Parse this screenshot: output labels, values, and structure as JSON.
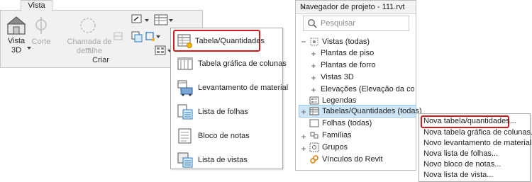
{
  "ribbon": {
    "tab_label": "Vista",
    "view3d_label": "Vista\n3D",
    "cut_label": "Corte",
    "callout_label": "Chamada de detalhe",
    "group_label": "Criar"
  },
  "schedules_menu": {
    "items": [
      {
        "label": "Tabela/Quantidades",
        "icon": "schedule-quantities-icon"
      },
      {
        "label": "Tabela gráfica de colunas",
        "icon": "graphical-column-schedule-icon"
      },
      {
        "label": "Levantamento de material",
        "icon": "material-takeoff-icon"
      },
      {
        "label": "Lista de folhas",
        "icon": "sheet-list-icon"
      },
      {
        "label": "Bloco de notas",
        "icon": "note-block-icon"
      },
      {
        "label": "Lista de vistas",
        "icon": "view-list-icon"
      }
    ],
    "highlight_color": "#d11b1b"
  },
  "project_browser": {
    "title": "Navegador de projeto - 111.rvt",
    "close": "✕",
    "search_placeholder": "Pesquisar",
    "tree": [
      {
        "label": "Vistas (todas)",
        "expander": "−"
      },
      {
        "label": "Plantas de piso",
        "expander": "+"
      },
      {
        "label": "Plantas de forro",
        "expander": "+"
      },
      {
        "label": "Vistas 3D",
        "expander": "+"
      },
      {
        "label": "Elevações (Elevação da constr",
        "expander": "+"
      },
      {
        "label": "Legendas",
        "expander": ""
      },
      {
        "label": "Tabelas/Quantidades (todas)",
        "expander": "+"
      },
      {
        "label": "Folhas (todas)",
        "expander": ""
      },
      {
        "label": "Famílias",
        "expander": "+"
      },
      {
        "label": "Grupos",
        "expander": "+"
      },
      {
        "label": "Vínculos do Revit",
        "expander": ""
      }
    ],
    "selection_color": "#cde6f7"
  },
  "context_menu": {
    "items": [
      "Nova tabela/quantidades...",
      "Nova tabela gráfica de colunas...",
      "Novo levantamento de material...",
      "Nova lista de folhas...",
      "Novo bloco de notas...",
      "Nova lista de vista..."
    ]
  }
}
